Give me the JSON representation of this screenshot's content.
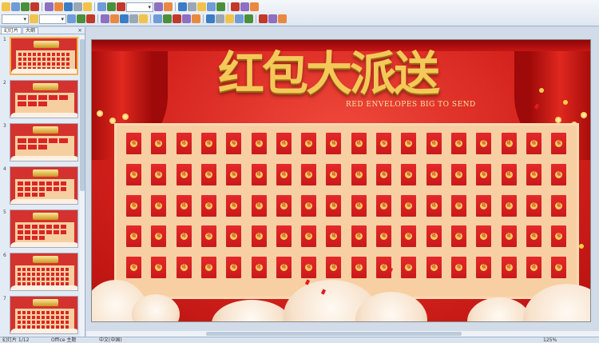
{
  "toolbar": {
    "row1_icons": [
      "new-icon",
      "open-icon",
      "save-icon",
      "permission-icon",
      "email-icon",
      "print-icon",
      "preview-icon",
      "spelling-icon",
      "research-icon",
      "cut-icon",
      "copy-icon",
      "paste-icon",
      "format-painter-icon",
      "undo-icon",
      "redo-icon",
      "hyperlink-icon",
      "table-icon",
      "chart-icon",
      "picture-icon",
      "grid-icon",
      "zoom-icon",
      "help-icon"
    ],
    "row2_icons": [
      "bold-icon",
      "italic-icon",
      "underline-icon",
      "shadow-icon",
      "align-left-icon",
      "align-center-icon",
      "align-right-icon",
      "numbering-icon",
      "bullets-icon",
      "increase-font-icon",
      "decrease-font-icon",
      "font-color-icon",
      "design-icon",
      "new-slide-icon",
      "fill-color-icon",
      "line-color-icon",
      "arrow-icon",
      "shapes-icon",
      "textbox-icon",
      "wordart-icon",
      "clipart-icon",
      "3d-icon"
    ]
  },
  "pane": {
    "tab_slides": "幻灯片",
    "tab_outline": "大纲",
    "close": "×",
    "slide_numbers": [
      "1",
      "2",
      "3",
      "4",
      "5",
      "6",
      "7"
    ]
  },
  "slide": {
    "title": "红包大派送",
    "subtitle": "RED ENVELOPES BIG TO SEND",
    "envelope_seal": "福",
    "rows": 5,
    "cols": 18
  },
  "status": {
    "slide_info": "幻灯片 1/12",
    "theme": "Office 主题",
    "language": "中文(中国)",
    "zoom": "125%"
  },
  "colors": {
    "background": "#d3211c",
    "gold": "#f4c95a",
    "envelope": "#e5292a",
    "board": "#f7cfa2"
  }
}
